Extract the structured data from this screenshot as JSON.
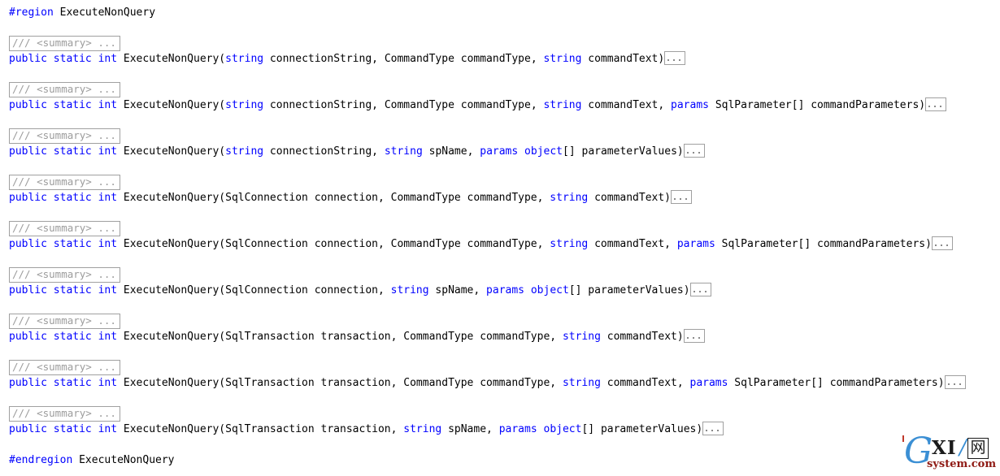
{
  "editor": {
    "background_color": "#ffffff",
    "keyword_color": "#0000ff",
    "text_color": "#000000",
    "collapsed_chip_border_color": "#a0a0a0",
    "collapsed_chip_text_color": "#9c9c9c",
    "region_open": {
      "directive": "#region",
      "name": " ExecuteNonQuery"
    },
    "region_close": {
      "directive": "#endregion",
      "name": " ExecuteNonQuery"
    },
    "summary_chip_label": "/// <summary> ...",
    "body_chip_label": "...",
    "members": [
      {
        "summary": "/// <summary> ...",
        "signature": [
          {
            "t": "public",
            "c": "kw"
          },
          {
            "t": " ",
            "c": "plain"
          },
          {
            "t": "static",
            "c": "kw"
          },
          {
            "t": " ",
            "c": "plain"
          },
          {
            "t": "int",
            "c": "kw"
          },
          {
            "t": " ExecuteNonQuery(",
            "c": "plain"
          },
          {
            "t": "string",
            "c": "kw"
          },
          {
            "t": " connectionString, CommandType commandType, ",
            "c": "plain"
          },
          {
            "t": "string",
            "c": "kw"
          },
          {
            "t": " commandText)",
            "c": "plain"
          }
        ]
      },
      {
        "summary": "/// <summary> ...",
        "signature": [
          {
            "t": "public",
            "c": "kw"
          },
          {
            "t": " ",
            "c": "plain"
          },
          {
            "t": "static",
            "c": "kw"
          },
          {
            "t": " ",
            "c": "plain"
          },
          {
            "t": "int",
            "c": "kw"
          },
          {
            "t": " ExecuteNonQuery(",
            "c": "plain"
          },
          {
            "t": "string",
            "c": "kw"
          },
          {
            "t": " connectionString, CommandType commandType, ",
            "c": "plain"
          },
          {
            "t": "string",
            "c": "kw"
          },
          {
            "t": " commandText, ",
            "c": "plain"
          },
          {
            "t": "params",
            "c": "kw"
          },
          {
            "t": " SqlParameter[] commandParameters)",
            "c": "plain"
          }
        ]
      },
      {
        "summary": "/// <summary> ...",
        "signature": [
          {
            "t": "public",
            "c": "kw"
          },
          {
            "t": " ",
            "c": "plain"
          },
          {
            "t": "static",
            "c": "kw"
          },
          {
            "t": " ",
            "c": "plain"
          },
          {
            "t": "int",
            "c": "kw"
          },
          {
            "t": " ExecuteNonQuery(",
            "c": "plain"
          },
          {
            "t": "string",
            "c": "kw"
          },
          {
            "t": " connectionString, ",
            "c": "plain"
          },
          {
            "t": "string",
            "c": "kw"
          },
          {
            "t": " spName, ",
            "c": "plain"
          },
          {
            "t": "params",
            "c": "kw"
          },
          {
            "t": " ",
            "c": "plain"
          },
          {
            "t": "object",
            "c": "kw"
          },
          {
            "t": "[] parameterValues)",
            "c": "plain"
          }
        ]
      },
      {
        "summary": "/// <summary> ...",
        "signature": [
          {
            "t": "public",
            "c": "kw"
          },
          {
            "t": " ",
            "c": "plain"
          },
          {
            "t": "static",
            "c": "kw"
          },
          {
            "t": " ",
            "c": "plain"
          },
          {
            "t": "int",
            "c": "kw"
          },
          {
            "t": " ExecuteNonQuery(SqlConnection connection, CommandType commandType, ",
            "c": "plain"
          },
          {
            "t": "string",
            "c": "kw"
          },
          {
            "t": " commandText)",
            "c": "plain"
          }
        ]
      },
      {
        "summary": "/// <summary> ...",
        "signature": [
          {
            "t": "public",
            "c": "kw"
          },
          {
            "t": " ",
            "c": "plain"
          },
          {
            "t": "static",
            "c": "kw"
          },
          {
            "t": " ",
            "c": "plain"
          },
          {
            "t": "int",
            "c": "kw"
          },
          {
            "t": " ExecuteNonQuery(SqlConnection connection, CommandType commandType, ",
            "c": "plain"
          },
          {
            "t": "string",
            "c": "kw"
          },
          {
            "t": " commandText, ",
            "c": "plain"
          },
          {
            "t": "params",
            "c": "kw"
          },
          {
            "t": " SqlParameter[] commandParameters)",
            "c": "plain"
          }
        ]
      },
      {
        "summary": "/// <summary> ...",
        "signature": [
          {
            "t": "public",
            "c": "kw"
          },
          {
            "t": " ",
            "c": "plain"
          },
          {
            "t": "static",
            "c": "kw"
          },
          {
            "t": " ",
            "c": "plain"
          },
          {
            "t": "int",
            "c": "kw"
          },
          {
            "t": " ExecuteNonQuery(SqlConnection connection, ",
            "c": "plain"
          },
          {
            "t": "string",
            "c": "kw"
          },
          {
            "t": " spName, ",
            "c": "plain"
          },
          {
            "t": "params",
            "c": "kw"
          },
          {
            "t": " ",
            "c": "plain"
          },
          {
            "t": "object",
            "c": "kw"
          },
          {
            "t": "[] parameterValues)",
            "c": "plain"
          }
        ]
      },
      {
        "summary": "/// <summary> ...",
        "signature": [
          {
            "t": "public",
            "c": "kw"
          },
          {
            "t": " ",
            "c": "plain"
          },
          {
            "t": "static",
            "c": "kw"
          },
          {
            "t": " ",
            "c": "plain"
          },
          {
            "t": "int",
            "c": "kw"
          },
          {
            "t": " ExecuteNonQuery(SqlTransaction transaction, CommandType commandType, ",
            "c": "plain"
          },
          {
            "t": "string",
            "c": "kw"
          },
          {
            "t": " commandText)",
            "c": "plain"
          }
        ]
      },
      {
        "summary": "/// <summary> ...",
        "signature": [
          {
            "t": "public",
            "c": "kw"
          },
          {
            "t": " ",
            "c": "plain"
          },
          {
            "t": "static",
            "c": "kw"
          },
          {
            "t": " ",
            "c": "plain"
          },
          {
            "t": "int",
            "c": "kw"
          },
          {
            "t": " ExecuteNonQuery(SqlTransaction transaction, CommandType commandType, ",
            "c": "plain"
          },
          {
            "t": "string",
            "c": "kw"
          },
          {
            "t": " commandText, ",
            "c": "plain"
          },
          {
            "t": "params",
            "c": "kw"
          },
          {
            "t": " SqlParameter[] commandParameters)",
            "c": "plain"
          }
        ]
      },
      {
        "summary": "/// <summary> ...",
        "signature": [
          {
            "t": "public",
            "c": "kw"
          },
          {
            "t": " ",
            "c": "plain"
          },
          {
            "t": "static",
            "c": "kw"
          },
          {
            "t": " ",
            "c": "plain"
          },
          {
            "t": "int",
            "c": "kw"
          },
          {
            "t": " ExecuteNonQuery(SqlTransaction transaction, ",
            "c": "plain"
          },
          {
            "t": "string",
            "c": "kw"
          },
          {
            "t": " spName, ",
            "c": "plain"
          },
          {
            "t": "params",
            "c": "kw"
          },
          {
            "t": " ",
            "c": "plain"
          },
          {
            "t": "object",
            "c": "kw"
          },
          {
            "t": "[] parameterValues)",
            "c": "plain"
          }
        ]
      }
    ]
  },
  "watermark": {
    "letter_g": "G",
    "letters_xi": "XI",
    "slash": "/",
    "cjk": "网",
    "domain": "system.com",
    "g_color": "#3b8fd4",
    "domain_color": "#8f1a14"
  }
}
